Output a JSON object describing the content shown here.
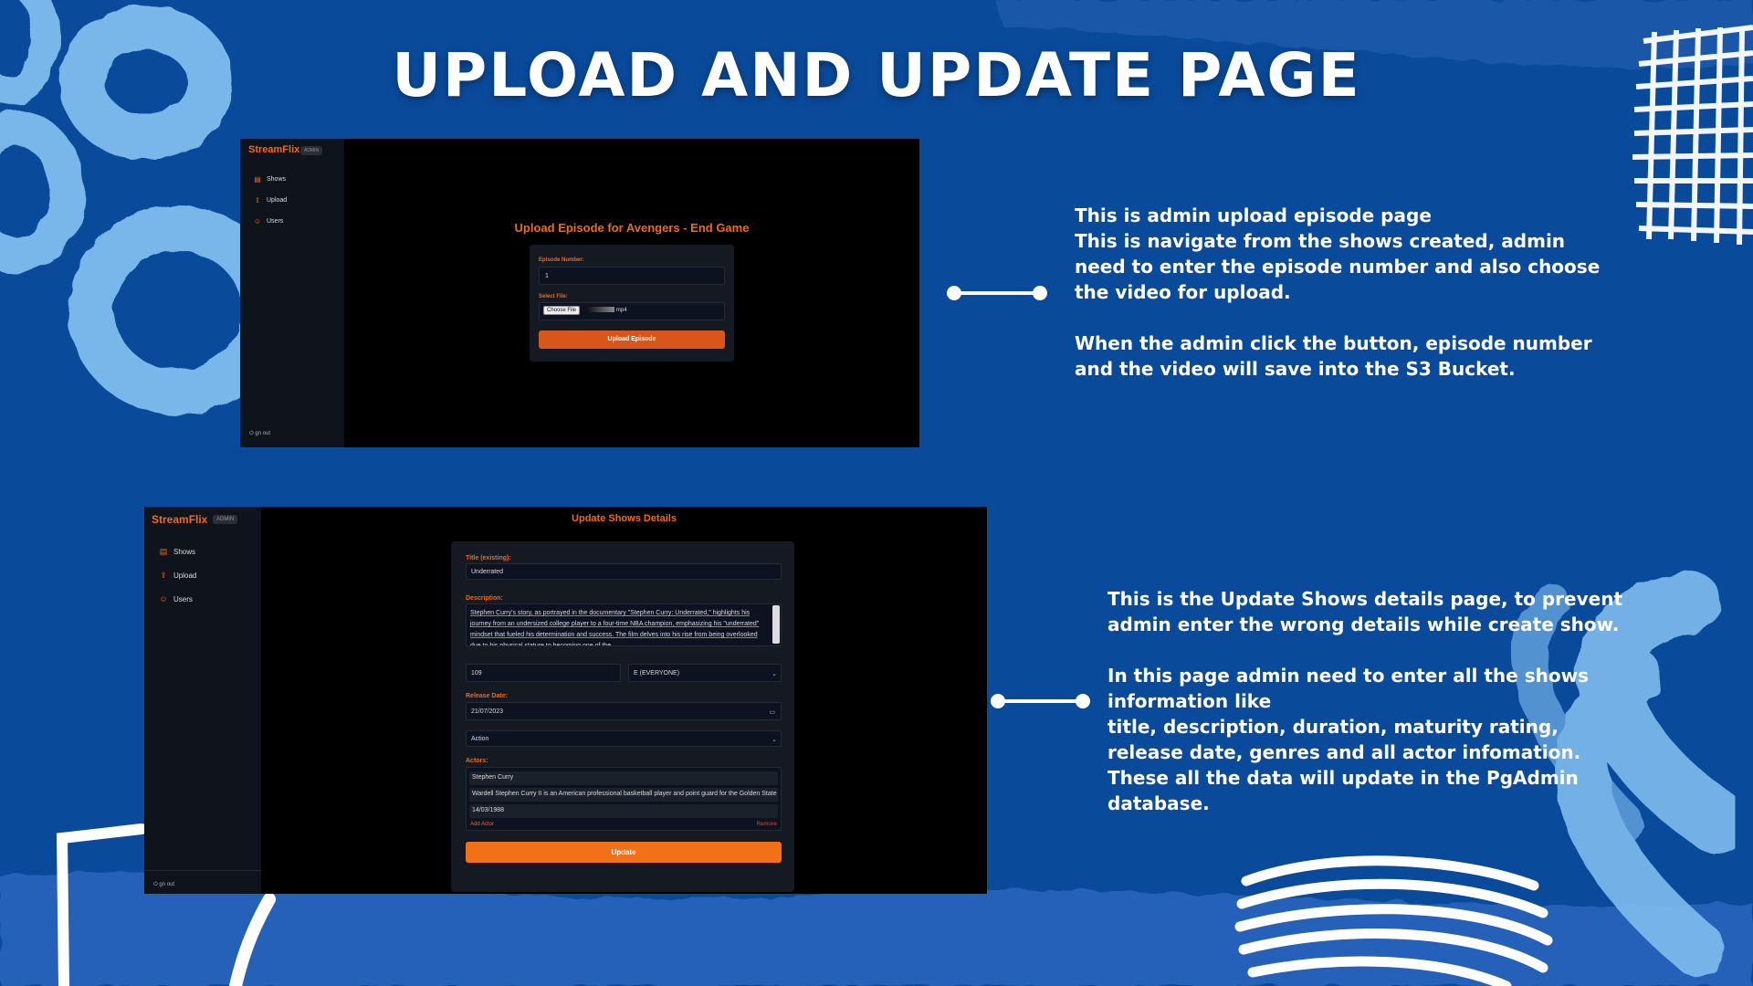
{
  "slide": {
    "title": "UPLOAD AND UPDATE PAGE"
  },
  "descriptions": {
    "upload": [
      "This is admin upload episode page\nThis is navigate from the shows created, admin need to enter the episode number and also choose the video for upload.",
      "When the admin click the button, episode number and the video will save into the S3 Bucket."
    ],
    "update": [
      "This is the Update Shows details page, to prevent admin enter the wrong details while create show.",
      "In this page admin need to enter all the shows information like\ntitle, description, duration, maturity rating, release date, genres and all actor infomation.\nThese all the data will update in the PgAdmin database."
    ]
  },
  "app": {
    "brand": "StreamFlix",
    "badge": "ADMIN",
    "nav": {
      "shows": "Shows",
      "upload": "Upload",
      "users": "Users"
    },
    "signout": "gn out",
    "icons": {
      "shows": "film-icon",
      "upload": "upload-icon",
      "users": "users-icon",
      "signout": "logout-icon"
    }
  },
  "upload_page": {
    "heading": "Upload Episode for Avengers - End Game",
    "episode_label": "Episode Number:",
    "episode_value": "1",
    "file_label": "Select File:",
    "choose_file": "Choose File",
    "file_name": "mp4",
    "submit": "Upload Episode"
  },
  "update_page": {
    "heading": "Update Shows Details",
    "title_label": "Title (existing):",
    "title_value": "Underrated",
    "description_label": "Description:",
    "description_value": "Stephen Curry's story, as portrayed in the documentary \"Stephen Curry: Underrated,\" highlights his journey from an undersized college player to a four-time NBA champion, emphasizing his \"underrated\" mindset that fueled his determination and success. The film delves into his rise from being overlooked due to his physical stature to becoming one of the",
    "duration_value": "109",
    "maturity_value": "E (EVERYONE)",
    "release_label": "Release Date:",
    "release_value": "21/07/2023",
    "genre_value": "Action",
    "actors_label": "Actors:",
    "actor_name": "Stephen Curry",
    "actor_bio": "Wardell Stephen Curry II is an American professional basketball player and point guard for the Golden State Warriors",
    "actor_dob": "14/03/1988",
    "add_actor": "Add Actor",
    "remove": "Remove",
    "submit": "Update"
  },
  "colors": {
    "background": "#0a4a9a",
    "accent": "#f06a18",
    "app_bg": "#000000",
    "sidebar_bg": "#0f141c"
  }
}
